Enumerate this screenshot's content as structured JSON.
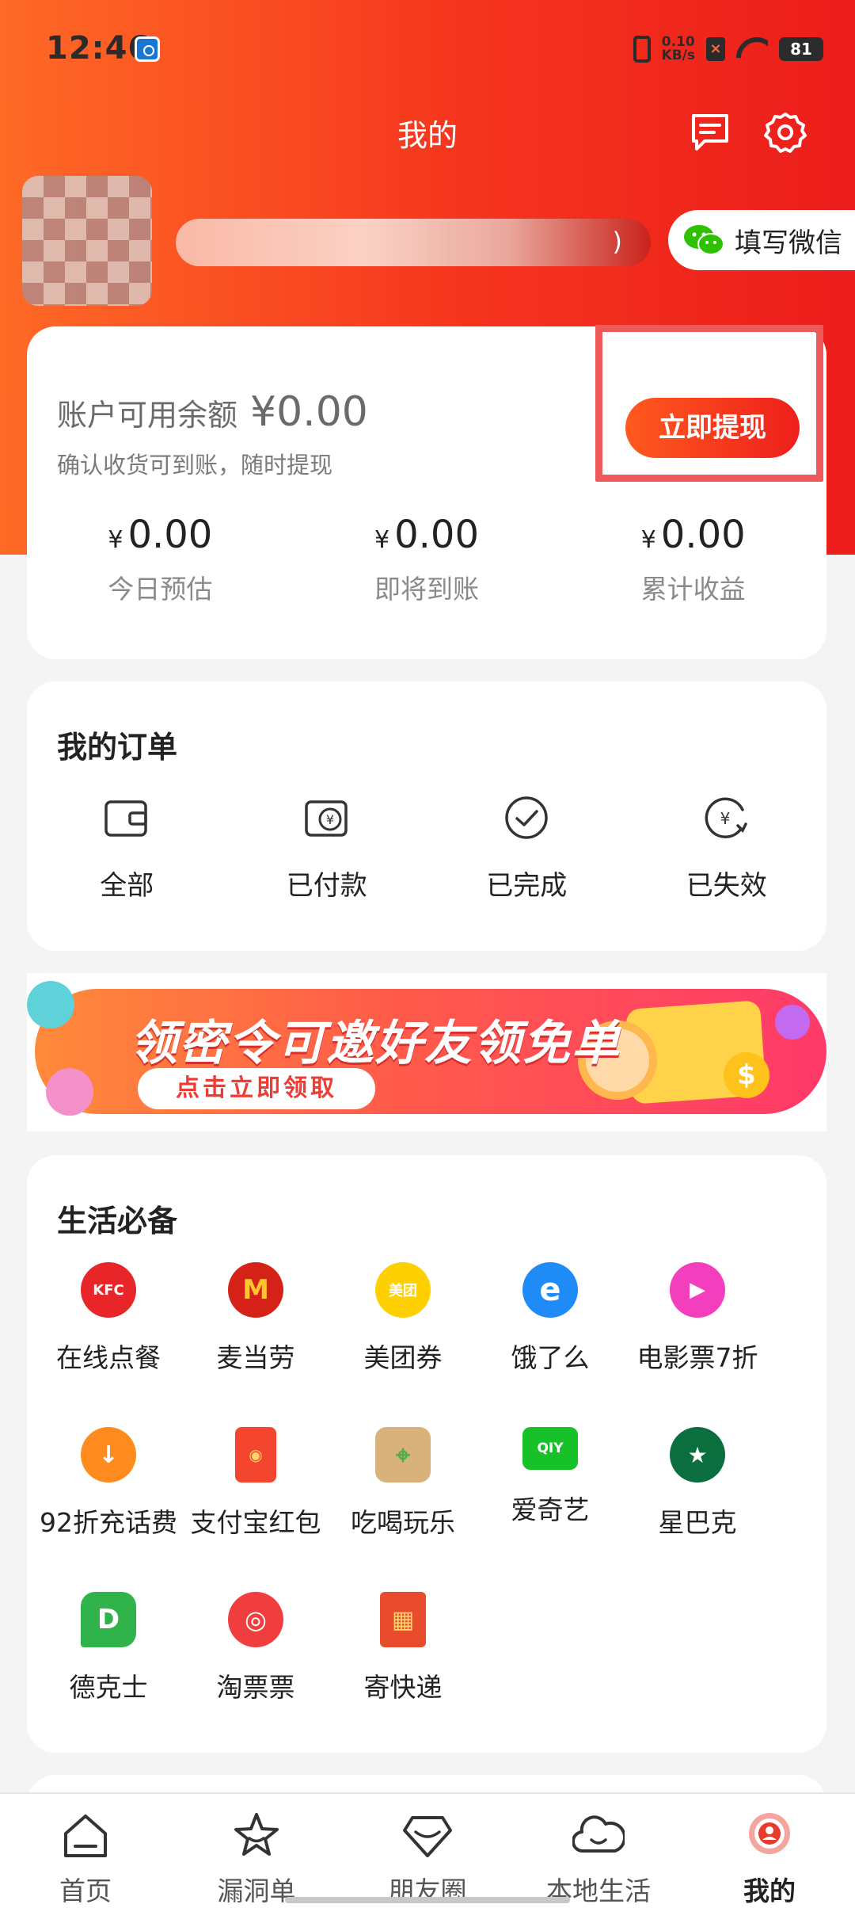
{
  "status_bar": {
    "time": "12:46",
    "net_speed_value": "0.10",
    "net_speed_unit": "KB/s",
    "battery": "81"
  },
  "header": {
    "title": "我的",
    "message_icon": "message-icon",
    "settings_icon": "gear-icon"
  },
  "profile": {
    "wechat_button_label": "填写微信",
    "nickname_suffix": ")"
  },
  "balance": {
    "label": "账户可用余额",
    "value": "¥0.00",
    "subtitle": "确认收货可到账，随时提现",
    "withdraw_label": "立即提现",
    "stats": [
      {
        "currency": "¥",
        "value": "0.00",
        "label": "今日预估"
      },
      {
        "currency": "¥",
        "value": "0.00",
        "label": "即将到账"
      },
      {
        "currency": "¥",
        "value": "0.00",
        "label": "累计收益"
      }
    ]
  },
  "orders": {
    "title": "我的订单",
    "items": [
      {
        "label": "全部",
        "icon": "wallet-icon"
      },
      {
        "label": "已付款",
        "icon": "paid-icon"
      },
      {
        "label": "已完成",
        "icon": "check-circle-icon"
      },
      {
        "label": "已失效",
        "icon": "expired-icon"
      }
    ]
  },
  "promo": {
    "title": "领密令可邀好友领免单",
    "cta": "点击立即领取",
    "coin_symbol": "$"
  },
  "life": {
    "title": "生活必备",
    "items": [
      {
        "label": "在线点餐",
        "icon": "kfc-icon",
        "badge": "KFC",
        "color": "#e8262a"
      },
      {
        "label": "麦当劳",
        "icon": "mcdonalds-icon",
        "badge": "M",
        "color": "#d62118"
      },
      {
        "label": "美团券",
        "icon": "meituan-icon",
        "badge": "美团",
        "color": "#ffd000"
      },
      {
        "label": "饿了么",
        "icon": "eleme-icon",
        "badge": "e",
        "color": "#1e8bf7"
      },
      {
        "label": "电影票7折",
        "icon": "movie-icon",
        "badge": "▶",
        "color": "#f33fbe"
      },
      {
        "label": "92折充话费",
        "icon": "recharge-icon",
        "badge": "↓",
        "color": "#ff8a1e"
      },
      {
        "label": "支付宝红包",
        "icon": "red-packet-icon",
        "badge": "◉",
        "color": "#f4452f"
      },
      {
        "label": "吃喝玩乐",
        "icon": "map-pin-icon",
        "badge": "⌖",
        "color": "#6cbf3a"
      },
      {
        "label": "爱奇艺",
        "icon": "iqiyi-icon",
        "badge": "QIY",
        "color": "#17c229"
      },
      {
        "label": "星巴克",
        "icon": "starbucks-icon",
        "badge": "★",
        "color": "#0b6e3f"
      },
      {
        "label": "德克士",
        "icon": "dicos-icon",
        "badge": "D",
        "color": "#2fb34a"
      },
      {
        "label": "淘票票",
        "icon": "taopiaopiao-icon",
        "badge": "◎",
        "color": "#f03e3e"
      },
      {
        "label": "寄快递",
        "icon": "express-icon",
        "badge": "▦",
        "color": "#e84c2c"
      }
    ]
  },
  "bottom_nav": [
    {
      "label": "首页",
      "icon": "home-icon"
    },
    {
      "label": "漏洞单",
      "icon": "star-icon"
    },
    {
      "label": "朋友圈",
      "icon": "diamond-icon"
    },
    {
      "label": "本地生活",
      "icon": "cloud-face-icon"
    },
    {
      "label": "我的",
      "icon": "profile-badge-icon"
    }
  ],
  "colors": {
    "brand_red": "#f5341e",
    "brand_orange": "#ff6a26",
    "highlight_frame": "#ee5a5a"
  }
}
